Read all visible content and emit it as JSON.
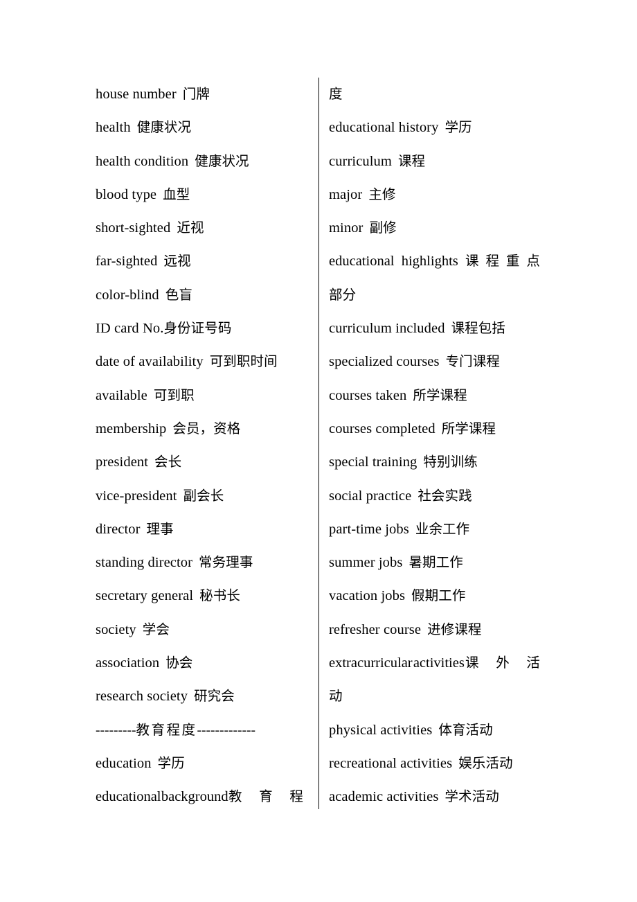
{
  "document": {
    "title": "English-Chinese Resume Vocabulary Glossary",
    "page_background": "#ffffff",
    "text_color": "#000000",
    "column_divider_color": "#000000"
  },
  "left_column": {
    "entries": [
      {
        "en": "house number",
        "zh": "门牌"
      },
      {
        "en": "health",
        "zh": "健康状况"
      },
      {
        "en": "health condition",
        "zh": "健康状况"
      },
      {
        "en": "blood type",
        "zh": "血型"
      },
      {
        "en": "short-sighted",
        "zh": "近视"
      },
      {
        "en": "far-sighted",
        "zh": "远视"
      },
      {
        "en": "color-blind",
        "zh": "色盲"
      },
      {
        "en": "ID card No.",
        "zh": "身份证号码",
        "tight": true
      },
      {
        "en": "date of availability",
        "zh": "可到职时间"
      },
      {
        "en": "available",
        "zh": "可到职"
      },
      {
        "en": "membership",
        "zh": "会员，资格"
      },
      {
        "en": "president",
        "zh": "会长"
      },
      {
        "en": "vice-president",
        "zh": "副会长"
      },
      {
        "en": "director",
        "zh": "理事"
      },
      {
        "en": "standing director",
        "zh": "常务理事"
      },
      {
        "en": "secretary general",
        "zh": "秘书长"
      },
      {
        "en": "society",
        "zh": "学会"
      },
      {
        "en": "association",
        "zh": "协会"
      },
      {
        "en": "research society",
        "zh": "研究会"
      }
    ],
    "separator": {
      "lead_dashes": "---------",
      "label": "教育程度",
      "trail_dashes": "-------------"
    },
    "entries_after_separator": [
      {
        "en": "education",
        "zh": "学历"
      },
      {
        "en": "educational",
        "en2": "background",
        "zh_chars": [
          "教",
          "育",
          "程"
        ],
        "justified": true
      }
    ]
  },
  "right_column": {
    "continuation_top": "度",
    "entries": [
      {
        "en": "educational history",
        "zh": "学历"
      },
      {
        "en": "curriculum",
        "zh": "课程"
      },
      {
        "en": "major",
        "zh": "主修"
      },
      {
        "en": "minor",
        "zh": "副修"
      },
      {
        "en": "educational",
        "en2": "highlights",
        "zh_chars": [
          "课",
          "程",
          "重",
          "点"
        ],
        "justified": true
      },
      {
        "cont": "部分"
      },
      {
        "en": "curriculum included",
        "zh": "课程包括"
      },
      {
        "en": "specialized courses",
        "zh": "专门课程"
      },
      {
        "en": "courses taken",
        "zh": "所学课程"
      },
      {
        "en": "courses completed",
        "zh": "所学课程"
      },
      {
        "en": "special training",
        "zh": "特别训练"
      },
      {
        "en": "social practice",
        "zh": "社会实践"
      },
      {
        "en": "part-time jobs",
        "zh": "业余工作"
      },
      {
        "en": "summer jobs",
        "zh": "暑期工作"
      },
      {
        "en": "vacation jobs",
        "zh": "假期工作"
      },
      {
        "en": "refresher course",
        "zh": "进修课程"
      },
      {
        "en": "extracurricular",
        "en2": "activities",
        "zh_chars": [
          "课",
          "外",
          "活"
        ],
        "justified": true
      },
      {
        "cont": "动"
      },
      {
        "en": "physical activities",
        "zh": "体育活动"
      },
      {
        "en": "recreational activities",
        "zh": "娱乐活动"
      },
      {
        "en": "academic activities",
        "zh": "学术活动"
      }
    ]
  }
}
